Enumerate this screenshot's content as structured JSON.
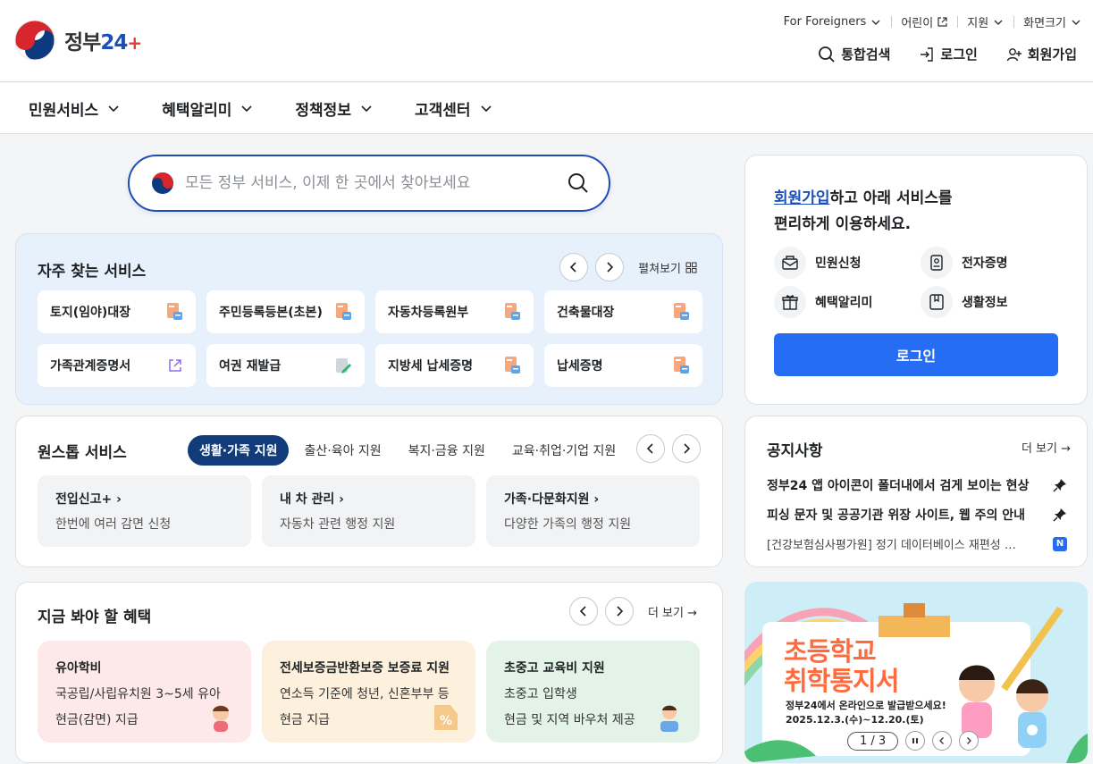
{
  "header": {
    "logo_text": "정부",
    "logo_num": "24",
    "logo_plus": "+",
    "util": {
      "foreigners": "For Foreigners",
      "kids": "어린이",
      "support": "지원",
      "screen_size": "화면크기"
    },
    "actions": {
      "search": "통합검색",
      "login": "로그인",
      "signup": "회원가입"
    }
  },
  "gnb": [
    "민원서비스",
    "혜택알리미",
    "정책정보",
    "고객센터"
  ],
  "search": {
    "placeholder": "모든 정부 서비스, 이제 한 곳에서 찾아보세요"
  },
  "frequent": {
    "title": "자주 찾는 서비스",
    "expand": "펼쳐보기",
    "items": [
      "토지(임야)대장",
      "주민등록등본(초본)",
      "자동차등록원부",
      "건축물대장",
      "가족관계증명서",
      "여권 재발급",
      "지방세 납세증명",
      "납세증명"
    ]
  },
  "onestop": {
    "title": "원스톱 서비스",
    "tabs": [
      "생활·가족 지원",
      "출산·육아 지원",
      "복지·금융 지원",
      "교육·취업·기업 지원"
    ],
    "items": [
      {
        "title": "전입신고+",
        "desc": "한번에 여러 감면 신청"
      },
      {
        "title": "내 차 관리",
        "desc": "자동차 관련 행정 지원"
      },
      {
        "title": "가족·다문화지원",
        "desc": "다양한 가족의 행정 지원"
      }
    ]
  },
  "benefit": {
    "title": "지금 봐야 할 혜택",
    "more": "더 보기",
    "items": [
      {
        "title": "유아학비",
        "l1": "국공립/사립유치원 3~5세 유아",
        "l2": "현금(감면) 지급"
      },
      {
        "title": "전세보증금반환보증 보증료 지원",
        "l1": "연소득 기준에 청년, 신혼부부 등",
        "l2": "현금 지급"
      },
      {
        "title": "초중고 교육비 지원",
        "l1": "초중고 입학생",
        "l2": "현금 및 지역 바우처 제공"
      }
    ]
  },
  "login": {
    "msg_link": "회원가입",
    "msg_1": "하고 아래 서비스를",
    "msg_2": "편리하게 이용하세요.",
    "services": [
      "민원신청",
      "전자증명",
      "혜택알리미",
      "생활정보"
    ],
    "button": "로그인"
  },
  "notice": {
    "title": "공지사항",
    "more": "더 보기",
    "items": [
      "정부24 앱 아이콘이 폴더내에서 검게 보이는 현상",
      "피싱 문자 및 공공기관 위장 사이트, 웹 주의 안내",
      "[건강보험심사평가원] 정기 데이터베이스 재편성 …"
    ],
    "new_badge": "N"
  },
  "banner": {
    "h1": "초등학교",
    "h2": "취학통지서",
    "s1": "정부24에서 온라인으로 발급받으세요!",
    "s2": "2025.12.3.(수)~12.20.(토)",
    "pager": "1 / 3"
  }
}
